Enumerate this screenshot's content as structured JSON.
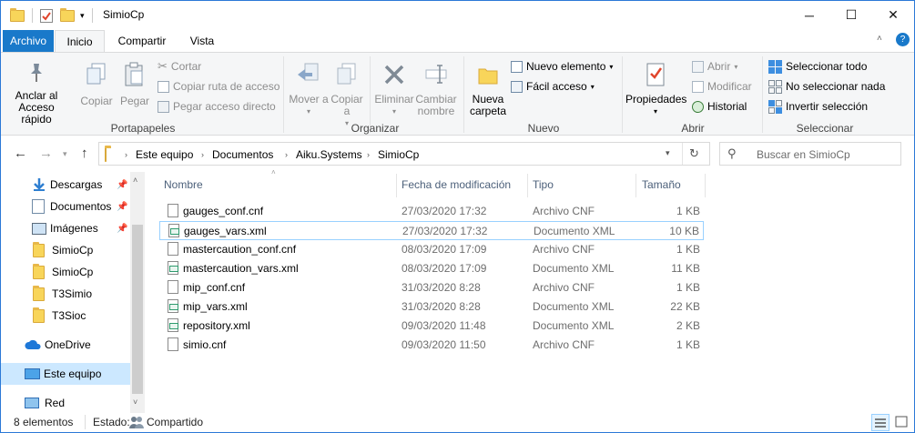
{
  "window": {
    "title": "SimioCp",
    "minimize_glyph": "─",
    "maximize_glyph": "☐",
    "close_glyph": "✕"
  },
  "tabs": [
    "Archivo",
    "Inicio",
    "Compartir",
    "Vista"
  ],
  "ribbon": {
    "portapapeles": {
      "label": "Portapapeles",
      "anclar": "Anclar al Acceso rápido",
      "copiar": "Copiar",
      "pegar": "Pegar",
      "cortar": "Cortar",
      "copiar_ruta": "Copiar ruta de acceso",
      "pegar_acceso": "Pegar acceso directo"
    },
    "organizar": {
      "label": "Organizar",
      "mover": "Mover a",
      "copiar": "Copiar a",
      "eliminar": "Eliminar",
      "cambiar": "Cambiar nombre"
    },
    "nuevo": {
      "label": "Nuevo",
      "nueva_carpeta": "Nueva carpeta",
      "nuevo_elemento": "Nuevo elemento",
      "facil_acceso": "Fácil acceso"
    },
    "abrir": {
      "label": "Abrir",
      "propiedades": "Propiedades",
      "abrir": "Abrir",
      "modificar": "Modificar",
      "historial": "Historial"
    },
    "seleccionar": {
      "label": "Seleccionar",
      "todo": "Seleccionar todo",
      "nada": "No seleccionar nada",
      "invertir": "Invertir selección"
    }
  },
  "address": {
    "crumbs": [
      "Este equipo",
      "Documentos",
      "Aiku.Systems",
      "SimioCp"
    ],
    "search_placeholder": "Buscar en SimioCp"
  },
  "nav": [
    {
      "label": "Descargas",
      "icon": "download-icon",
      "pinned": true
    },
    {
      "label": "Documentos",
      "icon": "documents-icon",
      "pinned": true
    },
    {
      "label": "Imágenes",
      "icon": "pictures-icon",
      "pinned": true
    },
    {
      "label": "SimioCp",
      "icon": "folder-icon",
      "pinned": false
    },
    {
      "label": "SimioCp",
      "icon": "folder-icon",
      "pinned": false
    },
    {
      "label": "T3Simio",
      "icon": "folder-icon",
      "pinned": false
    },
    {
      "label": "T3Sioc",
      "icon": "folder-icon",
      "pinned": false
    },
    {
      "label": "OneDrive",
      "icon": "cloud-icon",
      "pinned": false
    },
    {
      "label": "Este equipo",
      "icon": "computer-icon",
      "pinned": false,
      "selected": true
    },
    {
      "label": "Red",
      "icon": "network-icon",
      "pinned": false
    }
  ],
  "columns": {
    "name": "Nombre",
    "date": "Fecha de modificación",
    "type": "Tipo",
    "size": "Tamaño"
  },
  "files": [
    {
      "name": "gauges_conf.cnf",
      "date": "27/03/2020 17:32",
      "type": "Archivo CNF",
      "size": "1 KB",
      "kind": "cnf"
    },
    {
      "name": "gauges_vars.xml",
      "date": "27/03/2020 17:32",
      "type": "Documento XML",
      "size": "10 KB",
      "kind": "xml"
    },
    {
      "name": "mastercaution_conf.cnf",
      "date": "08/03/2020 17:09",
      "type": "Archivo CNF",
      "size": "1 KB",
      "kind": "cnf"
    },
    {
      "name": "mastercaution_vars.xml",
      "date": "08/03/2020 17:09",
      "type": "Documento XML",
      "size": "11 KB",
      "kind": "xml"
    },
    {
      "name": "mip_conf.cnf",
      "date": "31/03/2020 8:28",
      "type": "Archivo CNF",
      "size": "1 KB",
      "kind": "cnf"
    },
    {
      "name": "mip_vars.xml",
      "date": "31/03/2020 8:28",
      "type": "Documento XML",
      "size": "22 KB",
      "kind": "xml"
    },
    {
      "name": "repository.xml",
      "date": "09/03/2020 11:48",
      "type": "Documento XML",
      "size": "2 KB",
      "kind": "xml"
    },
    {
      "name": "simio.cnf",
      "date": "09/03/2020 11:50",
      "type": "Archivo CNF",
      "size": "1 KB",
      "kind": "cnf"
    }
  ],
  "status": {
    "count": "8 elementos",
    "state_label": "Estado:",
    "state_value": "Compartido"
  },
  "colors": {
    "accent": "#1979ca",
    "selection": "#cce8ff",
    "folder": "#f8d55a"
  }
}
